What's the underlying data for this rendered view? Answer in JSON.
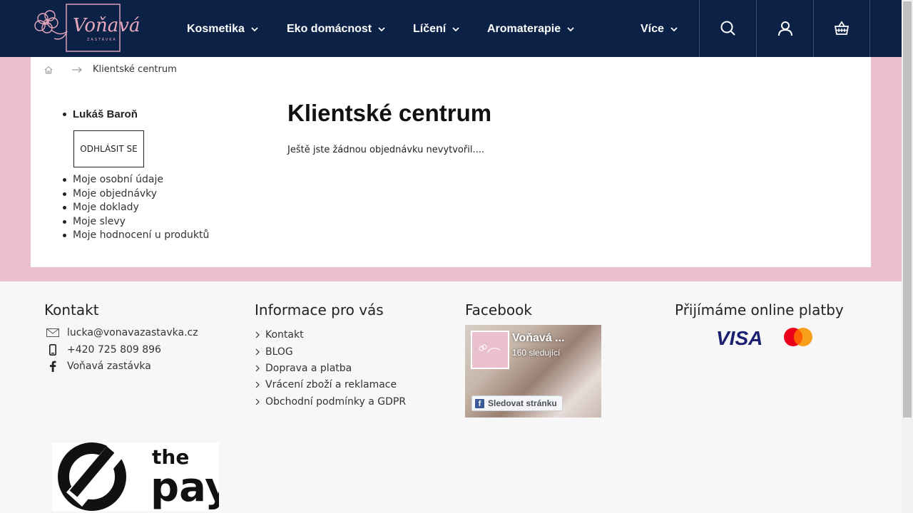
{
  "header": {
    "logo_text": "Voňavá",
    "logo_subtext": "ZASTÁVKA",
    "nav": [
      {
        "label": "Kosmetika"
      },
      {
        "label": "Eko domácnost"
      },
      {
        "label": "Líčení"
      },
      {
        "label": "Aromaterapie"
      },
      {
        "label": "Více"
      }
    ],
    "icons": [
      "search-icon",
      "user-icon",
      "basket-icon"
    ]
  },
  "breadcrumb": {
    "home_icon": "home-icon",
    "current": "Klientské centrum"
  },
  "sidebar": {
    "user_name": "Lukáš Baroň",
    "logout_label": "ODHLÁSIT SE",
    "links": [
      {
        "label": "Moje osobní údaje"
      },
      {
        "label": "Moje objednávky"
      },
      {
        "label": "Moje doklady"
      },
      {
        "label": "Moje slevy"
      },
      {
        "label": "Moje hodnocení u produktů"
      }
    ]
  },
  "main": {
    "title": "Klientské centrum",
    "message": "Ještě jste žádnou objednávku nevytvořil...."
  },
  "footer": {
    "contact": {
      "heading": "Kontakt",
      "email": "lucka@vonavazastavka.cz",
      "phone": "+420 725 809 896",
      "facebook": "Voňavá zastávka"
    },
    "info": {
      "heading": "Informace pro vás",
      "links": [
        {
          "label": "Kontakt"
        },
        {
          "label": "BLOG"
        },
        {
          "label": "Doprava a platba"
        },
        {
          "label": "Vrácení zboží a reklamace"
        },
        {
          "label": "Obchodní podmínky a GDPR"
        }
      ]
    },
    "facebook": {
      "heading": "Facebook",
      "page_name": "Voňavá ...",
      "followers": "160 sledující",
      "follow_label": "Sledovat stránku"
    },
    "payments": {
      "heading": "Přijímáme online platby",
      "visa_label": "VISA"
    },
    "thepay": {
      "text_top": "the",
      "text_bottom": "pay"
    }
  },
  "colors": {
    "header_bg": "#0b2145",
    "pink_band": "#e9c0cc",
    "footer_bg": "#f7f7f7"
  }
}
